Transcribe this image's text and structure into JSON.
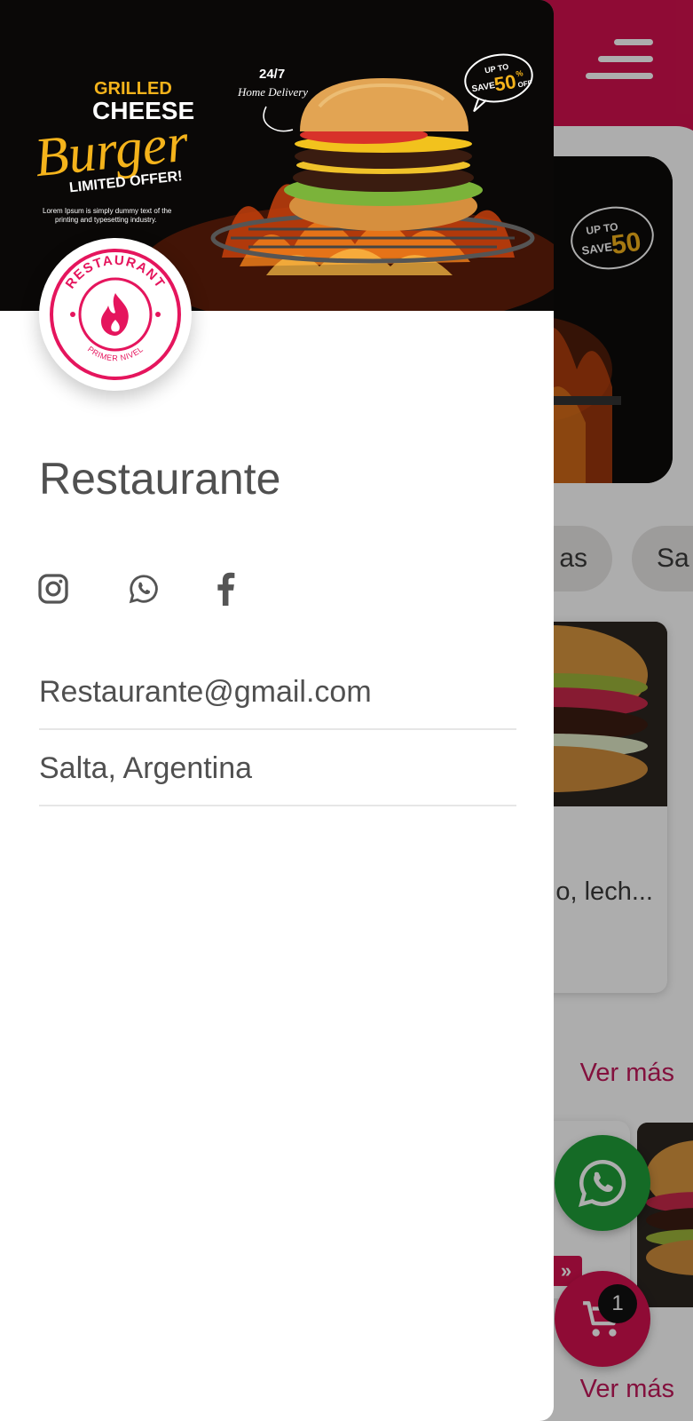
{
  "app": {
    "filter_chips": [
      "as",
      "Sa"
    ],
    "product_description": "o, lech...",
    "ver_mas_label": "Ver más",
    "cart_count": "1",
    "promo_tag": "»"
  },
  "drawer": {
    "banner": {
      "headline_1": "GRILLED",
      "headline_2": "CHEESE",
      "headline_3": "Burger",
      "headline_4": "LIMITED OFFER!",
      "tagline_1": "24/7",
      "tagline_2": "Home Delivery",
      "badge_top": "UP TO",
      "badge_save": "SAVE",
      "badge_pct": "50",
      "badge_sym": "%",
      "badge_off": "OFF",
      "filler_line_1": "Lorem Ipsum is simply dummy text of the",
      "filler_line_2": "printing and typesetting industry."
    },
    "logo": {
      "top_text": "RESTAURANT",
      "bottom_text": "PRIMER NIVEL",
      "icon": "flame-icon"
    },
    "title": "Restaurante",
    "socials": [
      {
        "name": "Instagram",
        "icon": "instagram-icon"
      },
      {
        "name": "WhatsApp",
        "icon": "whatsapp-icon"
      },
      {
        "name": "Facebook",
        "icon": "facebook-icon"
      }
    ],
    "email": "Restaurante@gmail.com",
    "location": "Salta, Argentina"
  },
  "colors": {
    "brand": "#d3114e",
    "whatsapp": "#1f9e39",
    "text": "#505050"
  }
}
